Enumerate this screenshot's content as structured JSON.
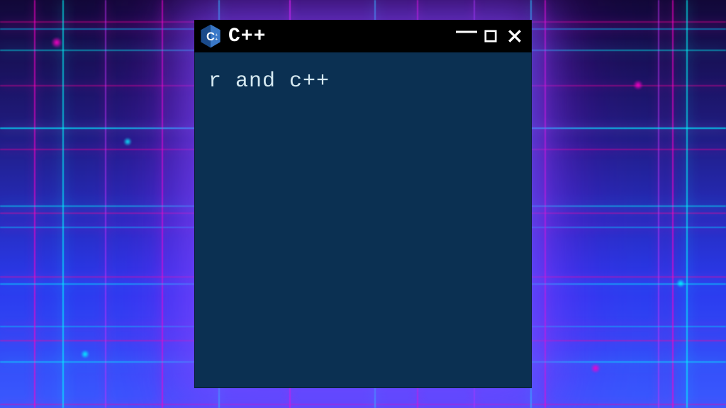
{
  "window": {
    "title": "C++",
    "icon_label": "C++",
    "controls": {
      "minimize": "–",
      "maximize": "▢",
      "close": "✕"
    }
  },
  "editor": {
    "content": "r and c++"
  },
  "colors": {
    "titlebar_bg": "#000000",
    "editor_bg": "#0b3052",
    "text": "#d5e8f0",
    "icon_blue": "#1a4a8a",
    "icon_blue_light": "#3a78c8"
  }
}
